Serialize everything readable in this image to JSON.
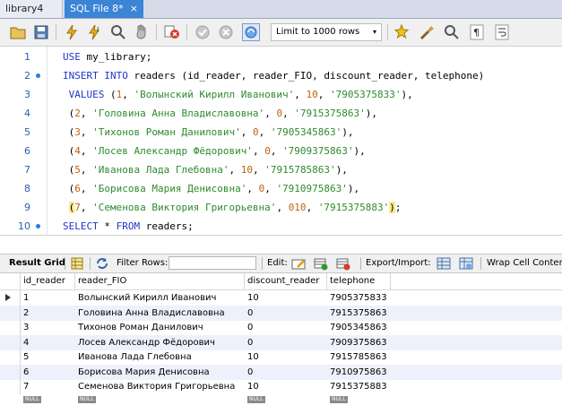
{
  "tabs": [
    {
      "label": "library4",
      "active": false
    },
    {
      "label": "SQL File 8*",
      "active": true
    }
  ],
  "tab_close_glyph": "×",
  "toolbar": {
    "icons": [
      "folder-open-icon",
      "save-icon",
      "execute-icon",
      "execute-current-icon",
      "explain-icon",
      "stop-icon",
      "toggle-error-icon",
      "commit-icon",
      "rollback-icon",
      "autocommit-icon",
      "beautify-icon",
      "find-icon",
      "invisible-chars-icon",
      "word-wrap-icon"
    ],
    "limit_label": "Limit to 1000 rows",
    "limit_caret": "▾"
  },
  "editor": {
    "lines": [
      {
        "n": "1",
        "dot": false,
        "tokens": [
          {
            "t": "USE",
            "c": "kw"
          },
          {
            "t": " my_library;",
            "c": ""
          }
        ]
      },
      {
        "n": "2",
        "dot": true,
        "tokens": [
          {
            "t": "INSERT INTO",
            "c": "kw"
          },
          {
            "t": " readers (id_reader, reader_FIO, discount_reader, telephone)",
            "c": ""
          }
        ]
      },
      {
        "n": "3",
        "dot": false,
        "tokens": [
          {
            "t": " VALUES",
            "c": "kw"
          },
          {
            "t": " (",
            "c": ""
          },
          {
            "t": "1",
            "c": "numc"
          },
          {
            "t": ", ",
            "c": ""
          },
          {
            "t": "'Волынский Кирилл Иванович'",
            "c": "str"
          },
          {
            "t": ", ",
            "c": ""
          },
          {
            "t": "10",
            "c": "numc"
          },
          {
            "t": ", ",
            "c": ""
          },
          {
            "t": "'7905375833'",
            "c": "str"
          },
          {
            "t": "),",
            "c": ""
          }
        ]
      },
      {
        "n": "4",
        "dot": false,
        "tokens": [
          {
            "t": " (",
            "c": ""
          },
          {
            "t": "2",
            "c": "numc"
          },
          {
            "t": ", ",
            "c": ""
          },
          {
            "t": "'Головина Анна Владиславовна'",
            "c": "str"
          },
          {
            "t": ", ",
            "c": ""
          },
          {
            "t": "0",
            "c": "numc"
          },
          {
            "t": ", ",
            "c": ""
          },
          {
            "t": "'7915375863'",
            "c": "str"
          },
          {
            "t": "),",
            "c": ""
          }
        ]
      },
      {
        "n": "5",
        "dot": false,
        "tokens": [
          {
            "t": " (",
            "c": ""
          },
          {
            "t": "3",
            "c": "numc"
          },
          {
            "t": ", ",
            "c": ""
          },
          {
            "t": "'Тихонов Роман Данилович'",
            "c": "str"
          },
          {
            "t": ", ",
            "c": ""
          },
          {
            "t": "0",
            "c": "numc"
          },
          {
            "t": ", ",
            "c": ""
          },
          {
            "t": "'7905345863'",
            "c": "str"
          },
          {
            "t": "),",
            "c": ""
          }
        ]
      },
      {
        "n": "6",
        "dot": false,
        "tokens": [
          {
            "t": " (",
            "c": ""
          },
          {
            "t": "4",
            "c": "numc"
          },
          {
            "t": ", ",
            "c": ""
          },
          {
            "t": "'Лосев Александр Фёдорович'",
            "c": "str"
          },
          {
            "t": ", ",
            "c": ""
          },
          {
            "t": "0",
            "c": "numc"
          },
          {
            "t": ", ",
            "c": ""
          },
          {
            "t": "'7909375863'",
            "c": "str"
          },
          {
            "t": "),",
            "c": ""
          }
        ]
      },
      {
        "n": "7",
        "dot": false,
        "tokens": [
          {
            "t": " (",
            "c": ""
          },
          {
            "t": "5",
            "c": "numc"
          },
          {
            "t": ", ",
            "c": ""
          },
          {
            "t": "'Иванова Лада Глебовна'",
            "c": "str"
          },
          {
            "t": ", ",
            "c": ""
          },
          {
            "t": "10",
            "c": "numc"
          },
          {
            "t": ", ",
            "c": ""
          },
          {
            "t": "'7915785863'",
            "c": "str"
          },
          {
            "t": "),",
            "c": ""
          }
        ]
      },
      {
        "n": "8",
        "dot": false,
        "tokens": [
          {
            "t": " (",
            "c": ""
          },
          {
            "t": "6",
            "c": "numc"
          },
          {
            "t": ", ",
            "c": ""
          },
          {
            "t": "'Борисова Мария Денисовна'",
            "c": "str"
          },
          {
            "t": ", ",
            "c": ""
          },
          {
            "t": "0",
            "c": "numc"
          },
          {
            "t": ", ",
            "c": ""
          },
          {
            "t": "'7910975863'",
            "c": "str"
          },
          {
            "t": "),",
            "c": ""
          }
        ]
      },
      {
        "n": "9",
        "dot": false,
        "tokens": [
          {
            "t": " ",
            "c": ""
          },
          {
            "t": "(",
            "c": "cur"
          },
          {
            "t": "7",
            "c": "numc"
          },
          {
            "t": ", ",
            "c": ""
          },
          {
            "t": "'Семенова Виктория Григорьевна'",
            "c": "str"
          },
          {
            "t": ", ",
            "c": ""
          },
          {
            "t": "010",
            "c": "numc"
          },
          {
            "t": ", ",
            "c": ""
          },
          {
            "t": "'7915375883'",
            "c": "str"
          },
          {
            "t": ")",
            "c": "cur"
          },
          {
            "t": ";",
            "c": ""
          }
        ]
      },
      {
        "n": "10",
        "dot": true,
        "tokens": [
          {
            "t": "SELECT",
            "c": "kw"
          },
          {
            "t": " * ",
            "c": ""
          },
          {
            "t": "FROM",
            "c": "kw"
          },
          {
            "t": " readers;",
            "c": ""
          }
        ]
      }
    ]
  },
  "result_bar": {
    "result_grid": "Result Grid",
    "filter_rows": "Filter Rows:",
    "edit": "Edit:",
    "export_import": "Export/Import:",
    "wrap_cell": "Wrap Cell Content"
  },
  "grid": {
    "columns": [
      "id_reader",
      "reader_FIO",
      "discount_reader",
      "telephone"
    ],
    "rows": [
      [
        "1",
        "Волынский Кирилл Иванович",
        "10",
        "7905375833"
      ],
      [
        "2",
        "Головина Анна Владиславовна",
        "0",
        "7915375863"
      ],
      [
        "3",
        "Тихонов Роман Данилович",
        "0",
        "7905345863"
      ],
      [
        "4",
        "Лосев Александр Фёдорович",
        "0",
        "7909375863"
      ],
      [
        "5",
        "Иванова Лада Глебовна",
        "10",
        "7915785863"
      ],
      [
        "6",
        "Борисова Мария Денисовна",
        "0",
        "7910975863"
      ],
      [
        "7",
        "Семенова Виктория Григорьевна",
        "10",
        "7915375883"
      ]
    ],
    "null_label": "NULL"
  }
}
